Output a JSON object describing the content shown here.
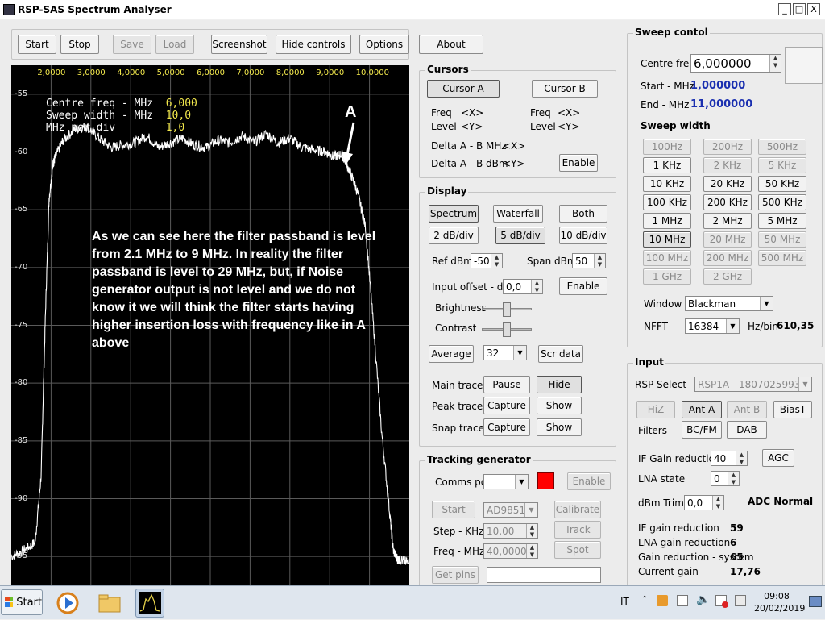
{
  "window": {
    "title": "RSP-SAS Spectrum Analyser",
    "buttons": {
      "minimize": "_",
      "maximize": "□",
      "close": "X"
    }
  },
  "toolbar": {
    "start": "Start",
    "stop": "Stop",
    "save": "Save",
    "load": "Load",
    "screenshot": "Screenshot",
    "hide_controls": "Hide controls",
    "options": "Options",
    "about": "About"
  },
  "plot": {
    "x_ticks": [
      "2,0000",
      "3,0000",
      "4,0000",
      "5,0000",
      "6,0000",
      "7,0000",
      "8,0000",
      "9,0000",
      "10,0000"
    ],
    "y_ticks": [
      "-55",
      "-60",
      "-65",
      "-70",
      "-75",
      "-80",
      "-85",
      "-90",
      "-95"
    ],
    "info": {
      "centre_label": "Centre freq - MHz",
      "centre_value": "6,000",
      "sweep_label": "Sweep width - MHz",
      "sweep_value": "10,0",
      "div_label": "MHz per div",
      "div_value": "1,0"
    },
    "marker": "A",
    "annotation": "As we can see here the filter passband is level from 2.1 MHz to 9 MHz. In reality the filter passband is level to 29 MHz, but, if Noise generator output is not level and we do not know it we will think the filter starts having higher insertion loss with frequency like in A above"
  },
  "chart_data": {
    "type": "line",
    "xlabel": "",
    "ylabel": "",
    "xlim": [
      1.0,
      11.0
    ],
    "ylim": [
      -97.5,
      -52.5
    ],
    "x": [
      1.0,
      1.3,
      1.6,
      1.75,
      1.85,
      1.95,
      2.05,
      2.1,
      2.3,
      2.6,
      2.9,
      3.2,
      3.5,
      3.8,
      4.1,
      4.4,
      4.7,
      5.0,
      5.3,
      5.6,
      5.9,
      6.2,
      6.5,
      6.8,
      7.1,
      7.4,
      7.7,
      8.0,
      8.3,
      8.6,
      8.9,
      9.1,
      9.3,
      9.5,
      9.7,
      9.9,
      10.1,
      10.3,
      10.5,
      10.6,
      10.7,
      10.8,
      11.0
    ],
    "series": [
      {
        "values": [
          -95,
          -94.5,
          -93.8,
          -88,
          -75,
          -64,
          -61,
          -60.5,
          -59,
          -58,
          -57.8,
          -58.8,
          -59.6,
          -59.4,
          -59.2,
          -58.6,
          -59.6,
          -59.2,
          -58.8,
          -59.4,
          -59.6,
          -59.0,
          -59.2,
          -58.6,
          -59.2,
          -58.4,
          -59.2,
          -58.8,
          -59.6,
          -59.8,
          -60.0,
          -60.4,
          -60.2,
          -61.6,
          -63.5,
          -66.5,
          -75,
          -84,
          -91,
          -94.5,
          -95.2,
          -95.3,
          -95.6
        ]
      }
    ],
    "grid": true,
    "line_color": "#ffffff",
    "background": "#000000"
  },
  "cursors": {
    "title": "Cursors",
    "cursor_a": "Cursor A",
    "cursor_b": "Cursor B",
    "freq_label": "Freq",
    "level_label": "Level",
    "x": "<X>",
    "y": "<Y>",
    "delta_mhz": "Delta A - B MHz",
    "delta_dbm": "Delta A - B dBm",
    "enable": "Enable"
  },
  "display": {
    "title": "Display",
    "spectrum": "Spectrum",
    "waterfall": "Waterfall",
    "both": "Both",
    "div2": "2 dB/div",
    "div5": "5 dB/div",
    "div10": "10 dB/div",
    "ref_label": "Ref dBm",
    "ref_value": "-50",
    "span_label": "Span dBm",
    "span_value": "50",
    "offset_label": "Input offset - dBm",
    "offset_value": "0,0",
    "enable": "Enable",
    "brightness": "Brightness",
    "contrast": "Contrast",
    "average": "Average",
    "average_value": "32",
    "scr_data": "Scr data",
    "main_trace": "Main trace",
    "pause": "Pause",
    "hide": "Hide",
    "peak_trace": "Peak trace",
    "capture": "Capture",
    "show": "Show",
    "snap_trace": "Snap trace"
  },
  "tracking": {
    "title": "Tracking generator",
    "comms_port": "Comms port",
    "enable": "Enable",
    "start": "Start",
    "device": "AD9851",
    "calibrate": "Calibrate",
    "step_label": "Step - KHz",
    "step_value": "10,00",
    "track": "Track",
    "freq_label": "Freq - MHz",
    "freq_value": "40,00000(",
    "spot": "Spot",
    "get_pins": "Get pins",
    "status_color": "#ff0000"
  },
  "sweep": {
    "title": "Sweep contol",
    "centre_label": "Centre freq",
    "centre_value": "6,000000",
    "start_label": "Start - MHz",
    "start_value": "1,000000",
    "end_label": "End - MHz",
    "end_value": "11,000000",
    "width_title": "Sweep width",
    "widths": [
      "100Hz",
      "200Hz",
      "500Hz",
      "1 KHz",
      "2 KHz",
      "5 KHz",
      "10 KHz",
      "20 KHz",
      "50 KHz",
      "100 KHz",
      "200 KHz",
      "500 KHz",
      "1 MHz",
      "2 MHz",
      "5 MHz",
      "10 MHz",
      "20 MHz",
      "50 MHz",
      "100 MHz",
      "200 MHz",
      "500 MHz",
      "1 GHz",
      "2 GHz"
    ],
    "window_label": "Window",
    "window_value": "Blackman",
    "nfft_label": "NFFT",
    "nfft_value": "16384",
    "hzbin_label": "Hz/bin",
    "hzbin_value": "610,35"
  },
  "input": {
    "title": "Input",
    "rsp_label": "RSP Select",
    "rsp_value": "RSP1A - 1807025993",
    "hiz": "HiZ",
    "ant_a": "Ant A",
    "ant_b": "Ant B",
    "bias_t": "BiasT",
    "filters_label": "Filters",
    "bcfm": "BC/FM",
    "dab": "DAB",
    "if_gain_label": "IF Gain reduction",
    "if_gain_value": "40",
    "agc": "AGC",
    "lna_label": "LNA state",
    "lna_value": "0",
    "dbm_trim_label": "dBm Trim",
    "dbm_trim_value": "0,0",
    "adc_status": "ADC Normal",
    "stats": [
      {
        "label": "IF gain reduction",
        "value": "59"
      },
      {
        "label": "LNA gain reduction",
        "value": "6"
      },
      {
        "label": "Gain reduction - system",
        "value": "65"
      },
      {
        "label": "Current gain",
        "value": "17,76"
      }
    ]
  },
  "taskbar": {
    "start": "Start",
    "language": "IT",
    "time": "09:08",
    "date": "20/02/2019"
  }
}
